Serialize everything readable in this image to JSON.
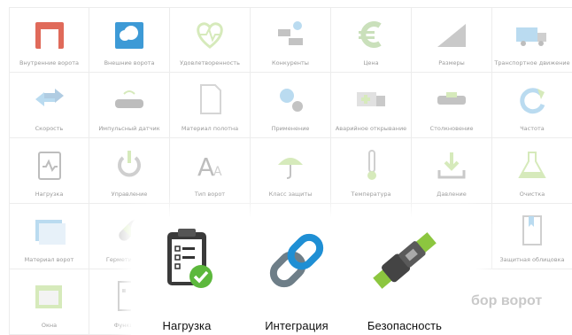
{
  "grid": {
    "rows": [
      [
        {
          "label": "Внутренние ворота",
          "icon": "inner-gate-icon"
        },
        {
          "label": "Внешние ворота",
          "icon": "outer-gate-weather-icon"
        },
        {
          "label": "Удовлетворенность",
          "icon": "heart-pulse-icon"
        },
        {
          "label": "Конкуренты",
          "icon": "competitors-icon"
        },
        {
          "label": "Цена",
          "icon": "euro-icon"
        },
        {
          "label": "Размеры",
          "icon": "ruler-triangle-icon"
        },
        {
          "label": "Транспортное движение",
          "icon": "truck-icon"
        }
      ],
      [
        {
          "label": "Скорость",
          "icon": "arrows-speed-icon"
        },
        {
          "label": "Импульсный датчик",
          "icon": "sensor-icon"
        },
        {
          "label": "Материал полотна",
          "icon": "document-icon"
        },
        {
          "label": "Применение",
          "icon": "gears-icon"
        },
        {
          "label": "Аварийное открывание",
          "icon": "ambulance-icon"
        },
        {
          "label": "Столкновение",
          "icon": "collision-icon"
        },
        {
          "label": "Частота",
          "icon": "refresh-icon"
        }
      ],
      [
        {
          "label": "Нагрузка",
          "icon": "load-chart-icon"
        },
        {
          "label": "Управление",
          "icon": "power-icon"
        },
        {
          "label": "Тип ворот",
          "icon": "font-icon"
        },
        {
          "label": "Класс защиты",
          "icon": "umbrella-icon"
        },
        {
          "label": "Температура",
          "icon": "thermometer-icon"
        },
        {
          "label": "Давление",
          "icon": "download-tray-icon"
        },
        {
          "label": "Очистка",
          "icon": "flask-icon"
        }
      ],
      [
        {
          "label": "Материал ворот",
          "icon": "panel-icon"
        },
        {
          "label": "Герметичность",
          "icon": "bandage-icon"
        },
        {
          "label": "",
          "icon": "blank-icon"
        },
        {
          "label": "",
          "icon": "blank-icon"
        },
        {
          "label": "",
          "icon": "blank-icon"
        },
        {
          "label": "",
          "icon": "blank-icon"
        },
        {
          "label": "Защитная облицовка",
          "icon": "bookmark-icon"
        }
      ],
      [
        {
          "label": "Окна",
          "icon": "folder-window-icon"
        },
        {
          "label": "Функцион",
          "icon": "function-list-icon"
        }
      ]
    ]
  },
  "popup": {
    "features": [
      {
        "label": "Нагрузка",
        "icon": "clipboard-check-icon"
      },
      {
        "label": "Интеграция",
        "icon": "chain-link-icon"
      },
      {
        "label": "Безопасность",
        "icon": "seatbelt-icon"
      }
    ]
  },
  "side_title": "бор ворот"
}
